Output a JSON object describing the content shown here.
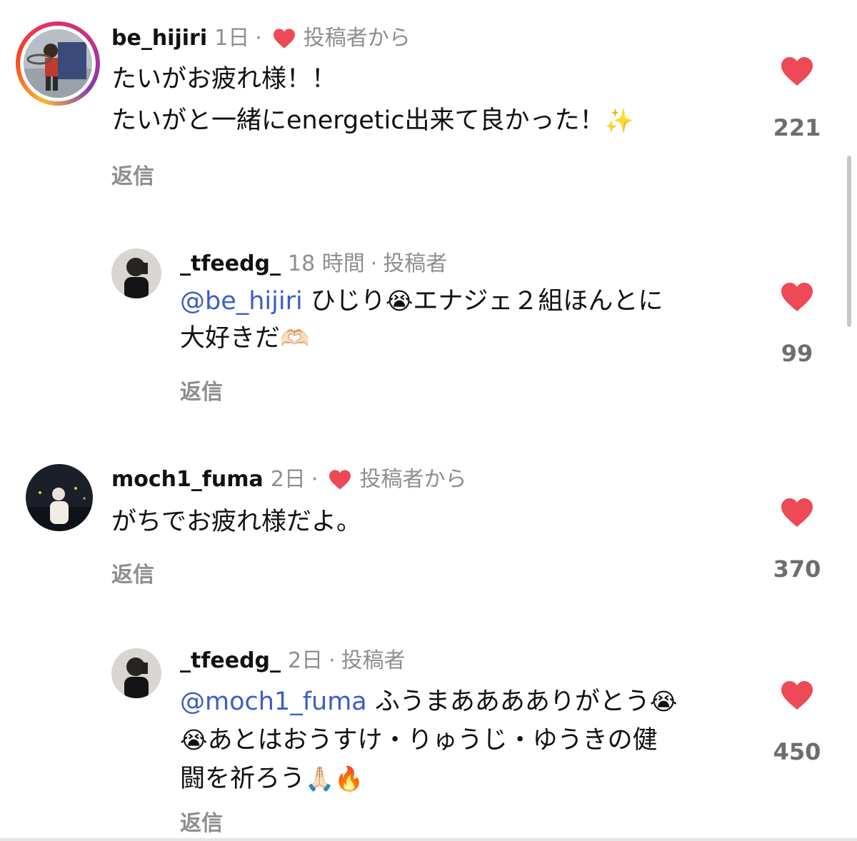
{
  "colors": {
    "heart_red": "#ed4956",
    "mention_blue": "#3d5dc8",
    "meta_grey": "#8e8e8e"
  },
  "comments": [
    {
      "username": "be_hijiri",
      "time": "1日",
      "liked_by_author": "投稿者から",
      "lines": [
        "たいがお疲れ様！！",
        "たいがと一緒にenergetic出来て良かった！"
      ],
      "emoji_line2": "✨",
      "reply_label": "返信",
      "like_count": "221",
      "heart_icon": "heart-filled-icon"
    },
    {
      "username": "_tfeedg_",
      "time": "18 時間",
      "author_badge": "投稿者",
      "mention": "@be_hijiri",
      "line1_rest": " ひじり",
      "emoji_cry": "😭",
      "line1_tail": "エナジェ２組ほんとに",
      "line2": "大好きだ",
      "emoji_heart_hands": "🫶🏻",
      "reply_label": "返信",
      "like_count": "99"
    },
    {
      "username": "moch1_fuma",
      "time": "2日",
      "liked_by_author": "投稿者から",
      "lines": [
        "がちでお疲れ様だよ。"
      ],
      "reply_label": "返信",
      "like_count": "370"
    },
    {
      "username": "_tfeedg_",
      "time": "2日",
      "author_badge": "投稿者",
      "mention": "@moch1_fuma",
      "line1_rest": " ふうまあああありがとう",
      "emoji_cry": "😭",
      "line2_emoji": "😭",
      "line2": "あとはおうすけ・りゅうじ・ゆうきの健",
      "line3": "闘を祈ろう",
      "emoji_pray": "🙏🏻",
      "emoji_fire": "🔥",
      "reply_label": "返信",
      "like_count": "450"
    }
  ],
  "separator": "·"
}
